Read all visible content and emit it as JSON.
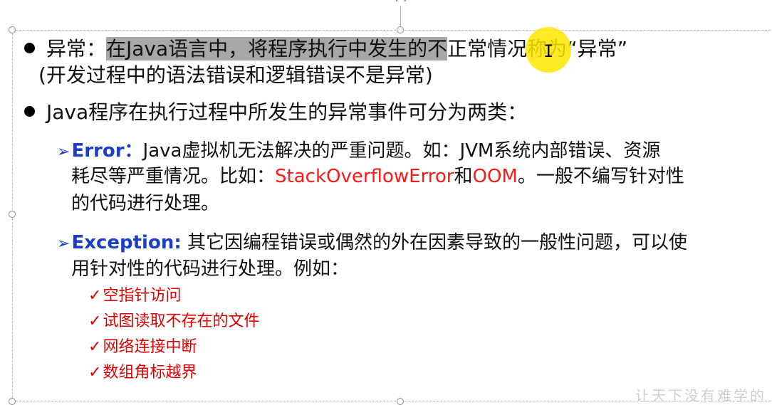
{
  "slide": {
    "bullet1": {
      "label": "异常：",
      "highlighted": "在Java语言中，将程序执行中发生的不",
      "after_cursor": "正常情况称为“异常”",
      "continuation": "(开发过程中的语法错误和逻辑错误不是异常)"
    },
    "bullet2": {
      "text": "Java程序在执行过程中所发生的异常事件可分为两类："
    },
    "error": {
      "term": "Error：",
      "line1": "Java虚拟机无法解决的严重问题。如：JVM系统内部错误、资源",
      "line2_pre": "耗尽等严重情况。比如：",
      "line2_red1": "StackOverflowError",
      "line2_mid": "和",
      "line2_red2": "OOM",
      "line2_post": "。一般不编写针对性",
      "line3": "的代码进行处理。"
    },
    "exception": {
      "term": "Exception:",
      "line1": " 其它因编程错误或偶然的外在因素导致的一般性问题，可以使",
      "line2": "用针对性的代码进行处理。例如：",
      "examples": [
        "空指针访问",
        "试图读取不存在的文件",
        "网络连接中断",
        "数组角标越界"
      ]
    },
    "watermark": "让天下没有难学的"
  },
  "icons": {
    "bullet": "filled-circle-bullet",
    "sub_bullet": "arrow-right-bullet",
    "example_bullet": "checkmark-icon",
    "cursor": "text-ibeam-cursor"
  },
  "colors": {
    "term_blue": "#1b3ec9",
    "emphasis_red": "#ff1a1a",
    "selection_gray": "#a8a8a8",
    "cursor_highlight": "#ffe600"
  }
}
